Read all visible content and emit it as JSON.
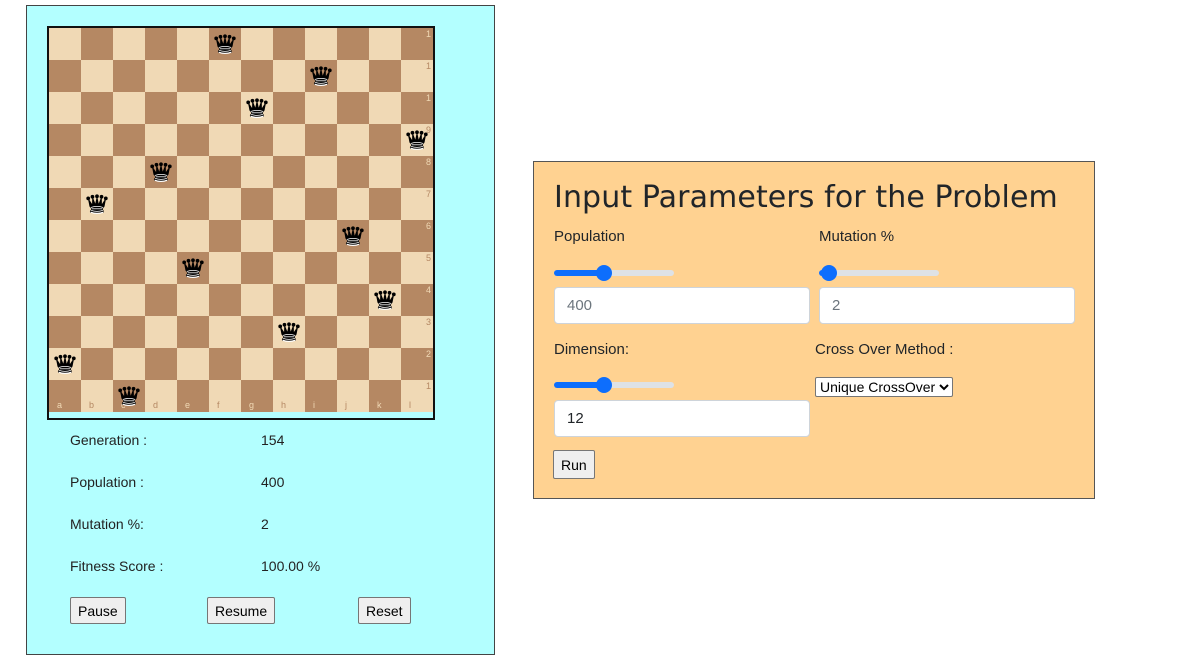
{
  "board": {
    "size": 12,
    "ranks": [
      "1",
      "1",
      "1",
      "9",
      "8",
      "7",
      "6",
      "5",
      "4",
      "3",
      "2",
      "1"
    ],
    "files": [
      "a",
      "b",
      "c",
      "d",
      "e",
      "f",
      "g",
      "h",
      "i",
      "j",
      "k",
      "l"
    ],
    "queen_columns_by_row": [
      5,
      8,
      6,
      11,
      3,
      1,
      9,
      4,
      10,
      7,
      0,
      2
    ],
    "light_color": "#f0d9b5",
    "dark_color": "#b58863"
  },
  "stats": {
    "generation_label": "Generation :",
    "generation_value": "154",
    "population_label": "Population :",
    "population_value": "400",
    "mutation_label": "Mutation %:",
    "mutation_value": "2",
    "fitness_label": "Fitness Score :",
    "fitness_value": "100.00 %"
  },
  "controls": {
    "pause_label": "Pause",
    "resume_label": "Resume",
    "reset_label": "Reset"
  },
  "params": {
    "title": "Input Parameters for the Problem",
    "population_label": "Population",
    "population_placeholder": "400",
    "population_slider_fraction": 0.4,
    "mutation_label": "Mutation %",
    "mutation_placeholder": "2",
    "mutation_slider_fraction": 0.02,
    "dimension_label": "Dimension:",
    "dimension_value": "12",
    "dimension_slider_fraction": 0.4,
    "crossover_label": "Cross Over Method :",
    "crossover_selected": "Unique CrossOver",
    "run_label": "Run",
    "accent_color": "#0d6efd",
    "panel_color": "#ffd291"
  },
  "left_panel_color": "#b3ffff"
}
